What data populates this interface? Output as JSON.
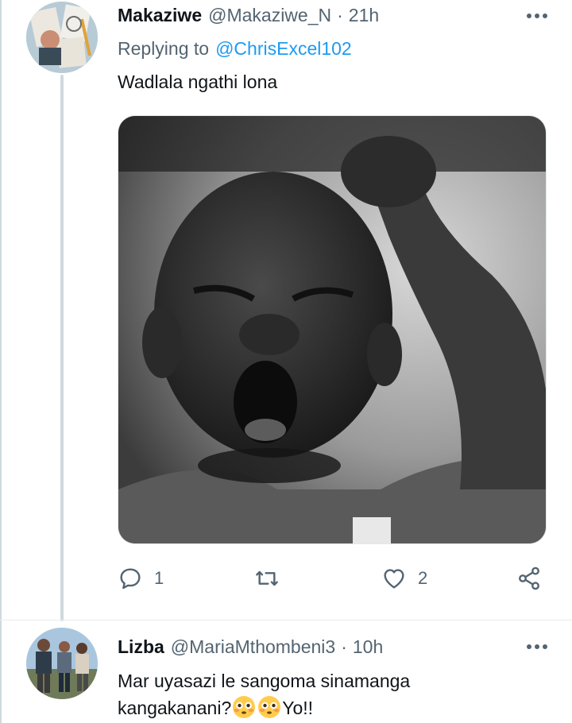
{
  "tweets": [
    {
      "display_name": "Makaziwe",
      "handle": "@Makaziwe_N",
      "separator": "·",
      "time": "21h",
      "replying_to_label": "Replying to",
      "replying_to_handle": "@ChrisExcel102",
      "text": "Wadlala ngathi lona",
      "media_icon": "photo-of-child-yawning",
      "actions": {
        "reply_count": "1",
        "retweet_count": "",
        "like_count": "2"
      }
    },
    {
      "display_name": "Lizba",
      "handle": "@MariaMthombeni3",
      "separator": "·",
      "time": "10h",
      "text_part1": "Mar uyasazi le sangoma sinamanga kangakanani?",
      "text_part2": "Yo!!",
      "emoji_icon": "flushed-face-emoji"
    }
  ],
  "colors": {
    "accent": "#1d9bf0",
    "secondary_text": "#536471",
    "primary_text": "#0f1419",
    "thread_line": "#cfd9de"
  }
}
